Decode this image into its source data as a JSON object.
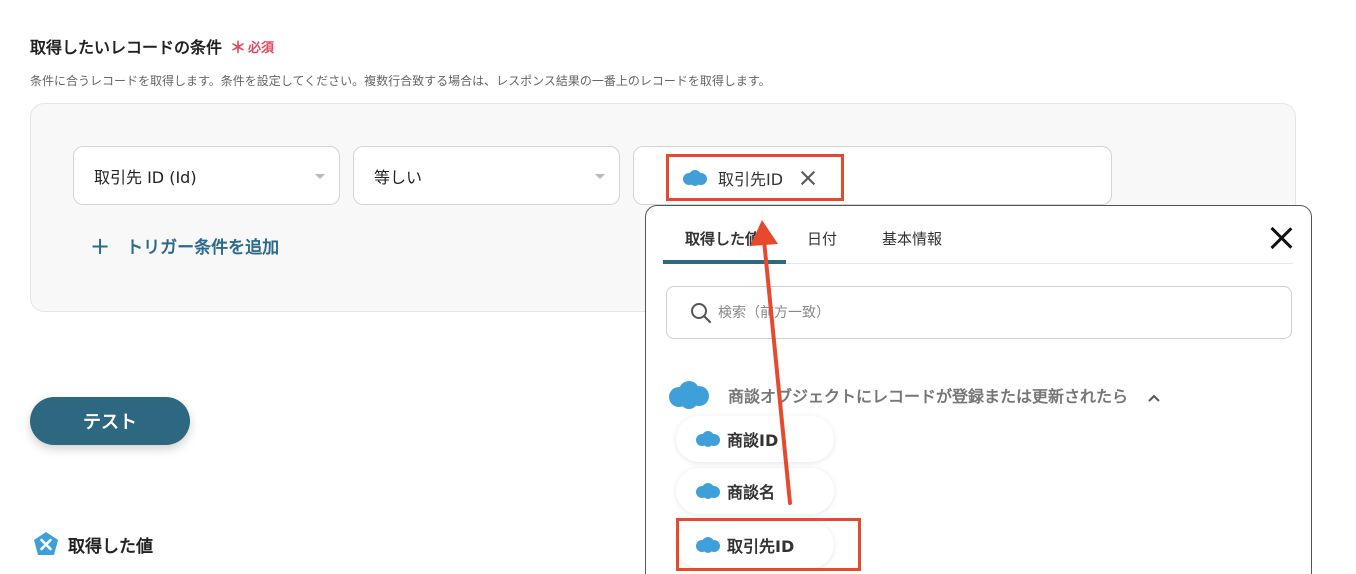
{
  "section": {
    "title": "取得したいレコードの条件",
    "required_star": "＊",
    "required_label": "必須",
    "description": "条件に合うレコードを取得します。条件を設定してください。複数行合致する場合は、レスポンス結果の一番上のレコードを取得します。"
  },
  "condition": {
    "field": "取引先 ID (Id)",
    "operator": "等しい",
    "value_token": "取引先ID",
    "add_trigger": "トリガー条件を追加",
    "add_icon": "+"
  },
  "test_button": "テスト",
  "retrieved_label": "取得した値",
  "popup": {
    "tabs": [
      "取得した値",
      "日付",
      "基本情報"
    ],
    "search_placeholder": "検索（前方一致）",
    "group_title": "商談オブジェクトにレコードが登録または更新されたら",
    "items": [
      "商談ID",
      "商談名",
      "取引先ID"
    ]
  },
  "colors": {
    "accent": "#2d6880",
    "highlight": "#e64a2e",
    "required": "#e04a5f",
    "salesforce_cloud": "#3fa0d9"
  }
}
